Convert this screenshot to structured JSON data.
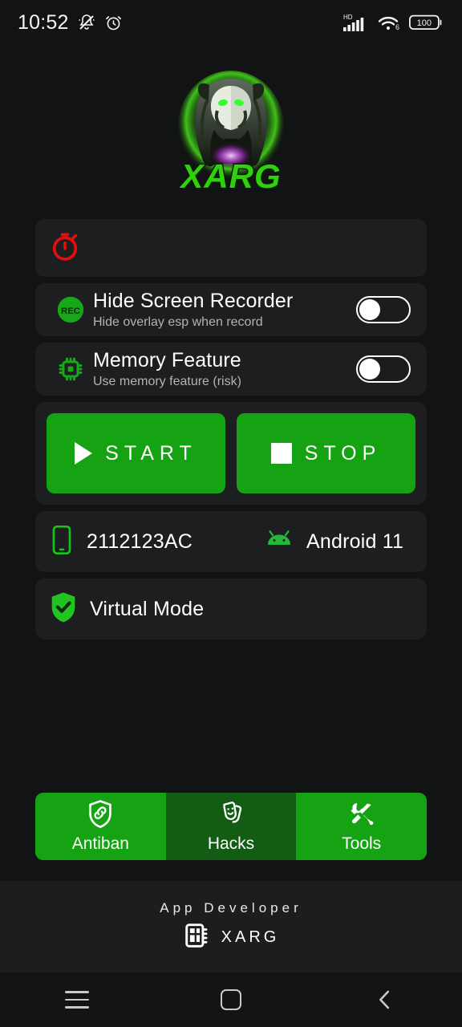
{
  "status_bar": {
    "time": "10:52",
    "icons_left": [
      "bell-slash-icon",
      "alarm-icon"
    ],
    "network_label": "HD",
    "wifi_label": "6",
    "battery_level": "100"
  },
  "logo": {
    "name": "xarg-logo",
    "wordmark": "XARG",
    "glow_color": "#3ddc1e"
  },
  "timer_row": {
    "icon": "stopwatch-icon",
    "icon_color": "#e80d0d",
    "value": ""
  },
  "settings": [
    {
      "icon": "rec-icon",
      "icon_label": "REC",
      "title": "Hide Screen Recorder",
      "subtitle": "Hide overlay esp when record",
      "toggle_state": "off"
    },
    {
      "icon": "memory-chip-icon",
      "icon_label": "",
      "title": "Memory Feature",
      "subtitle": "Use memory feature (risk)",
      "toggle_state": "off"
    }
  ],
  "actions": {
    "start_label": "START",
    "stop_label": "STOP",
    "button_color": "#15a314"
  },
  "device_info": {
    "device_icon": "smartphone-icon",
    "device_model": "2112123AC",
    "os_icon": "android-icon",
    "os_version": "Android 11",
    "mode_icon": "shield-check-icon",
    "mode_label": "Virtual Mode"
  },
  "tabs": [
    {
      "icon": "shield-link-icon",
      "label": "Antiban",
      "active": true
    },
    {
      "icon": "theater-masks-icon",
      "label": "Hacks",
      "active": false
    },
    {
      "icon": "tools-icon",
      "label": "Tools",
      "active": true
    }
  ],
  "footer": {
    "developer_label": "App Developer",
    "developer_icon": "chip-card-icon",
    "developer_name": "XARG"
  },
  "navbar": {
    "recents": "recents-icon",
    "home": "home-icon",
    "back": "back-icon"
  }
}
